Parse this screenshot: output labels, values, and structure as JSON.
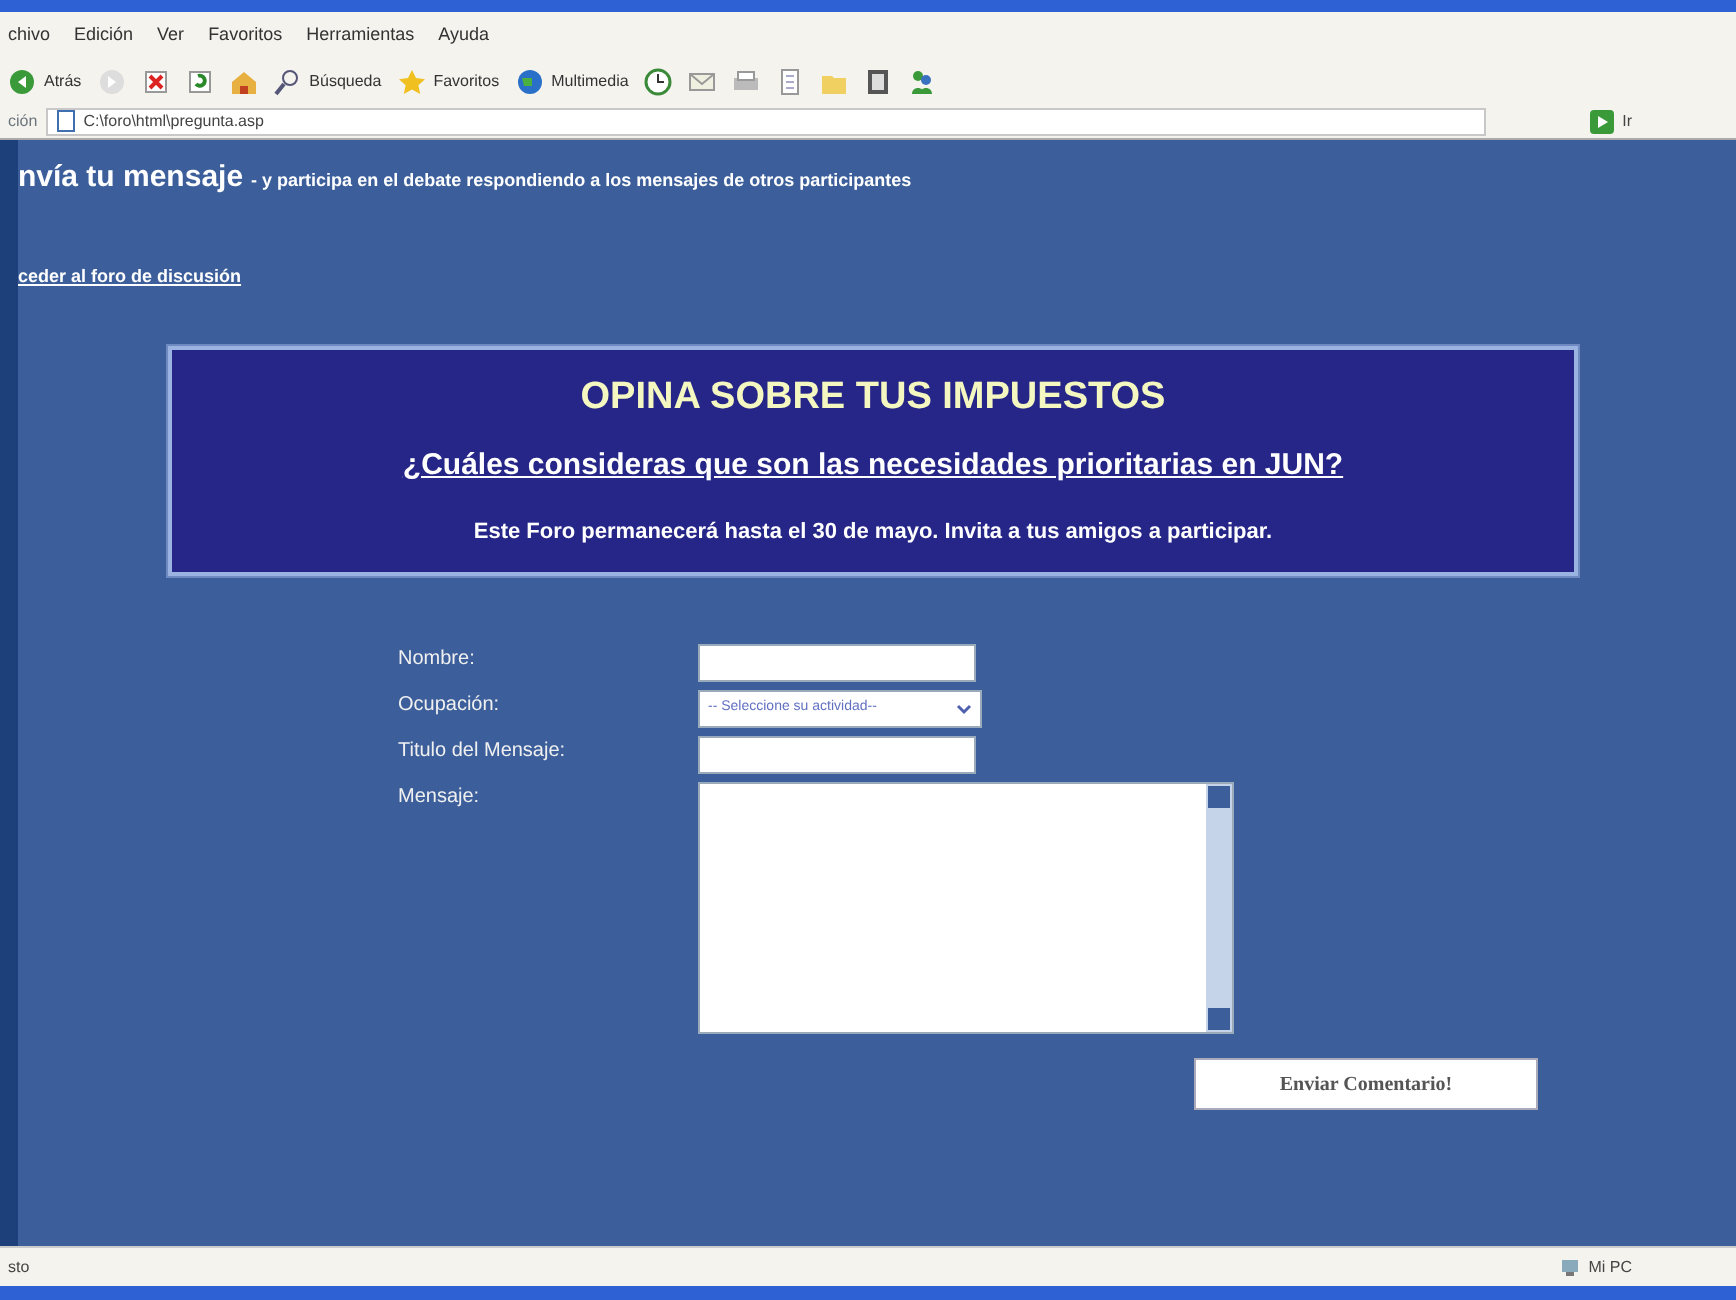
{
  "menu": [
    "chivo",
    "Edición",
    "Ver",
    "Favoritos",
    "Herramientas",
    "Ayuda"
  ],
  "toolbar": [
    {
      "kind": "back",
      "label": "Atrás"
    },
    {
      "kind": "forward"
    },
    {
      "kind": "stop"
    },
    {
      "kind": "refresh"
    },
    {
      "kind": "home"
    },
    {
      "kind": "search",
      "label": "Búsqueda"
    },
    {
      "kind": "star",
      "label": "Favoritos"
    },
    {
      "kind": "globe",
      "label": "Multimedia"
    },
    {
      "kind": "history"
    },
    {
      "kind": "mail"
    },
    {
      "kind": "print"
    },
    {
      "kind": "edit"
    },
    {
      "kind": "folder"
    },
    {
      "kind": "book"
    },
    {
      "kind": "messenger"
    }
  ],
  "address": {
    "label": "ción",
    "value": "C:\\foro\\html\\pregunta.asp",
    "go": "Ir"
  },
  "header": {
    "title": "nvía tu mensaje",
    "subtitle": "- y participa en el debate respondiendo a los mensajes de otros participantes"
  },
  "forum_link": "ceder al foro de discusión",
  "banner": {
    "title": "OPINA SOBRE TUS IMPUESTOS",
    "question": "¿Cuáles consideras que son las necesidades prioritarias en JUN?",
    "note": "Este Foro permanecerá hasta el 30 de mayo. Invita a tus amigos a participar."
  },
  "form": {
    "fields": [
      {
        "kind": "text",
        "label": "Nombre:"
      },
      {
        "kind": "select",
        "label": "Ocupación:",
        "value": "-- Seleccione su actividad--"
      },
      {
        "kind": "text",
        "label": "Titulo del Mensaje:"
      },
      {
        "kind": "textarea",
        "label": "Mensaje:"
      }
    ],
    "submit": "Enviar Comentario!"
  },
  "status_bar": {
    "text": "sto",
    "zone": "Mi PC"
  }
}
